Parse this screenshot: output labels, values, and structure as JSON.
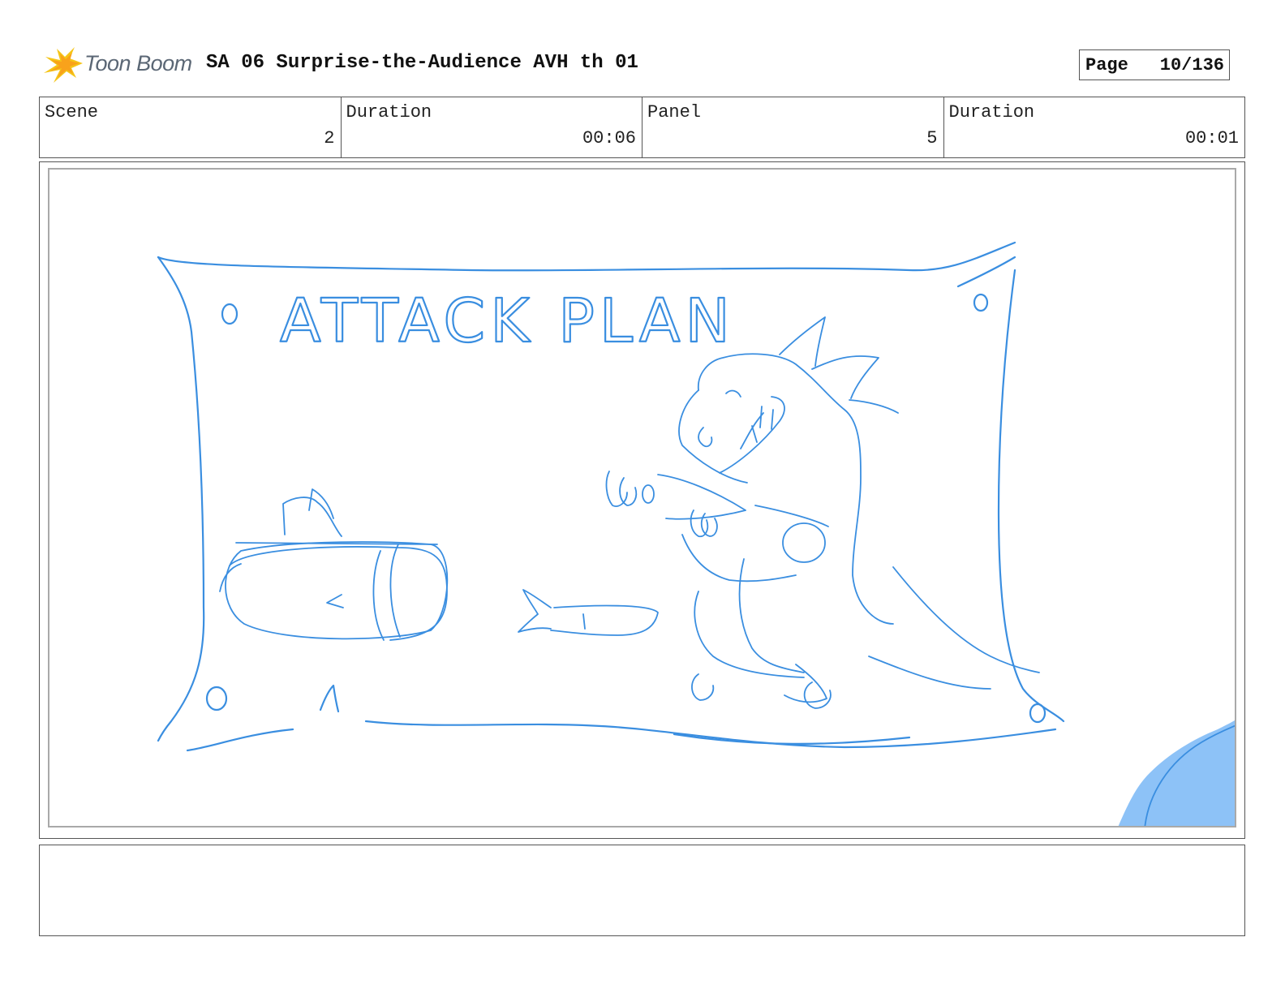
{
  "header": {
    "logo_text": "Toon Boom",
    "title": "SA 06 Surprise-the-Audience AVH th 01",
    "page_label": "Page",
    "page_value": "10/136"
  },
  "info": {
    "scene_label": "Scene",
    "scene_value": "2",
    "scene_duration_label": "Duration",
    "scene_duration_value": "00:06",
    "panel_label": "Panel",
    "panel_value": "5",
    "panel_duration_label": "Duration",
    "panel_duration_value": "00:01"
  },
  "panel": {
    "sketch_text": "ATTACK PLAN",
    "sketch_color": "#3a8ee0",
    "overlay_color": "#8dc2f7"
  },
  "notes": {
    "text": ""
  }
}
